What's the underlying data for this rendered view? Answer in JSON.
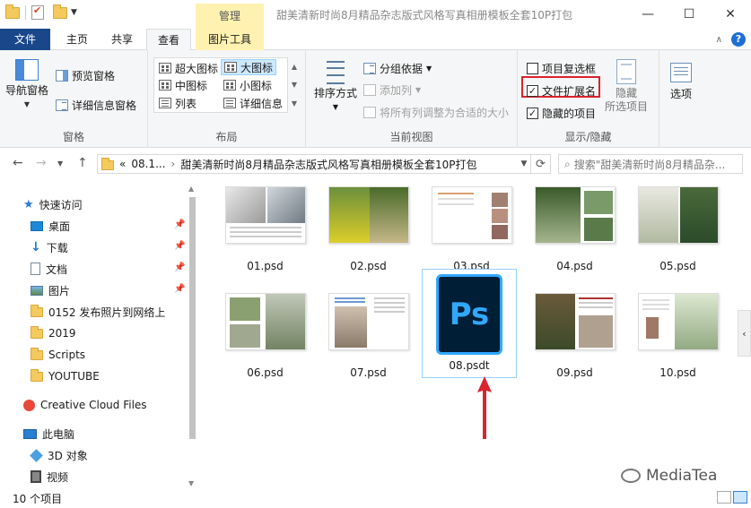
{
  "window": {
    "title": "甜美清新时尚8月精品杂志版式风格写真相册模板全套10P打包",
    "context_tab_group": "管理",
    "controls": [
      "—",
      "☐",
      "✕"
    ]
  },
  "tabs": {
    "file": "文件",
    "home": "主页",
    "share": "共享",
    "view": "查看",
    "picture_tools": "图片工具"
  },
  "ribbon": {
    "panes": {
      "label": "窗格",
      "nav_pane": "导航窗格",
      "preview_pane": "预览窗格",
      "details_pane": "详细信息窗格"
    },
    "layout": {
      "label": "布局",
      "items": [
        "超大图标",
        "大图标",
        "中图标",
        "小图标",
        "列表",
        "详细信息"
      ],
      "selected": "大图标"
    },
    "current_view": {
      "label": "当前视图",
      "sort_by": "排序方式",
      "group_by": "分组依据",
      "add_columns": "添加列",
      "size_all_columns": "将所有列调整为合适的大小"
    },
    "show_hide": {
      "label": "显示/隐藏",
      "item_checkboxes": "项目复选框",
      "item_checkboxes_checked": false,
      "file_name_extensions": "文件扩展名",
      "file_name_extensions_checked": true,
      "hidden_items": "隐藏的项目",
      "hidden_items_checked": true,
      "hide": "隐藏",
      "hide_selected": "所选项目"
    },
    "options": "选项",
    "highlight_color": "#d9232d"
  },
  "address": {
    "path_prefix": "«",
    "path_parent": "08.1...",
    "path_current": "甜美清新时尚8月精品杂志版式风格写真相册模板全套10P打包",
    "search_placeholder": "搜索\"甜美清新时尚8月精品杂..."
  },
  "sidebar": {
    "quick_access": "快速访问",
    "items": [
      {
        "label": "桌面",
        "icon": "desktop-icon",
        "pinned": true
      },
      {
        "label": "下载",
        "icon": "download-icon",
        "pinned": true
      },
      {
        "label": "文档",
        "icon": "document-icon",
        "pinned": true
      },
      {
        "label": "图片",
        "icon": "pictures-icon",
        "pinned": true
      },
      {
        "label": "0152 发布照片到网络上",
        "icon": "folder-icon",
        "pinned": false
      },
      {
        "label": "2019",
        "icon": "folder-icon",
        "pinned": false
      },
      {
        "label": "Scripts",
        "icon": "folder-icon",
        "pinned": false
      },
      {
        "label": "YOUTUBE",
        "icon": "folder-icon",
        "pinned": false
      }
    ],
    "creative_cloud": "Creative Cloud Files",
    "this_pc": "此电脑",
    "pc_items": [
      {
        "label": "3D 对象",
        "icon": "3d-objects-icon"
      },
      {
        "label": "视频",
        "icon": "video-icon"
      }
    ]
  },
  "files": [
    {
      "name": "01.psd"
    },
    {
      "name": "02.psd"
    },
    {
      "name": "03.psd"
    },
    {
      "name": "04.psd"
    },
    {
      "name": "05.psd"
    },
    {
      "name": "06.psd"
    },
    {
      "name": "07.psd"
    },
    {
      "name": "08.psdt",
      "selected": true,
      "icon": "photoshop-icon",
      "icon_text": "Ps"
    },
    {
      "name": "09.psd"
    },
    {
      "name": "10.psd"
    }
  ],
  "status": {
    "item_count": "10 个项目"
  },
  "watermark": "MediaTea",
  "colors": {
    "file_tab": "#19478a",
    "context_tab": "#fff2b0",
    "ps_bg": "#001e36",
    "ps_accent": "#31a8ff",
    "annotation_arrow": "#d9232d"
  }
}
